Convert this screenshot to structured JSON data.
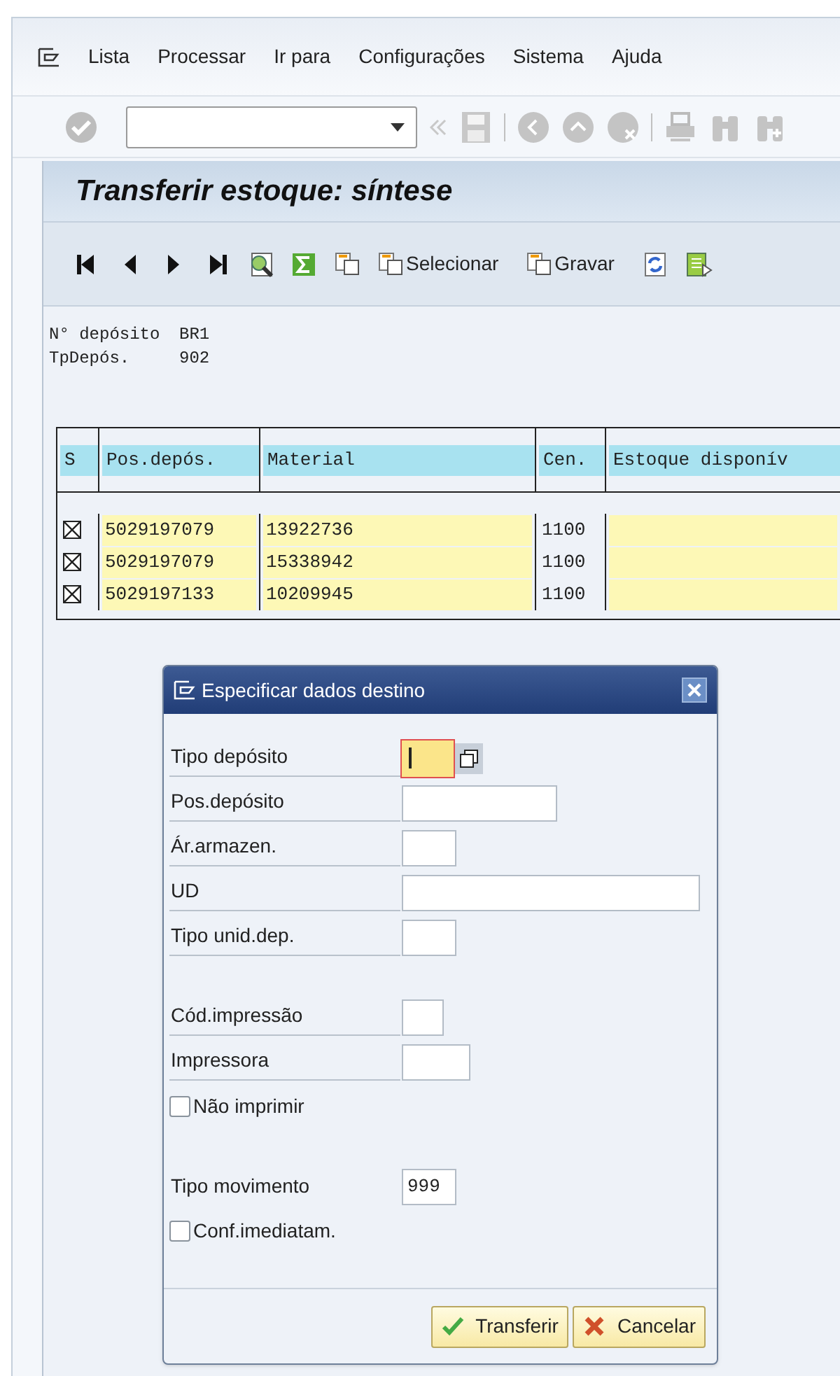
{
  "menu": [
    "Lista",
    "Processar",
    "Ir para",
    "Configurações",
    "Sistema",
    "Ajuda"
  ],
  "title": "Transferir estoque: síntese",
  "app_toolbar": [
    {
      "kind": "first"
    },
    {
      "kind": "prev"
    },
    {
      "kind": "next"
    },
    {
      "kind": "last"
    },
    {
      "kind": "details"
    },
    {
      "kind": "sum"
    },
    {
      "kind": "copy"
    },
    {
      "kind": "copy",
      "label": "Selecionar"
    },
    {
      "kind": "copy",
      "label": "Gravar"
    },
    {
      "kind": "refresh"
    },
    {
      "kind": "list"
    }
  ],
  "header_fields": [
    {
      "label": "N° depósito",
      "value": "BR1"
    },
    {
      "label": "TpDepós.",
      "value": "902"
    }
  ],
  "table": {
    "columns": [
      "S",
      "Pos.depós.",
      "Material",
      "Cen.",
      "Estoque disponív"
    ],
    "rows": [
      {
        "selected": true,
        "cells": [
          "",
          "5029197079",
          "13922736",
          "1100"
        ]
      },
      {
        "selected": true,
        "cells": [
          "",
          "5029197079",
          "15338942",
          "1100"
        ]
      },
      {
        "selected": true,
        "cells": [
          "",
          "5029197133",
          "10209945",
          "1100"
        ]
      }
    ]
  },
  "dialog": {
    "title": "Especificar dados destino",
    "sections": [
      [
        {
          "kind": "field",
          "label": "Tipo depósito",
          "focused": true
        },
        {
          "kind": "field",
          "label": "Pos.depósito",
          "focused": false
        },
        {
          "kind": "field",
          "label": "Ár.armazen.",
          "focused": false
        },
        {
          "kind": "field",
          "label": "UD",
          "focused": false
        },
        {
          "kind": "field",
          "label": "Tipo unid.dep.",
          "focused": false
        }
      ],
      [
        {
          "kind": "field",
          "label": "Cód.impressão",
          "focused": false
        },
        {
          "kind": "field",
          "label": "Impressora",
          "focused": false
        },
        {
          "kind": "checkbox",
          "label": "Não imprimir",
          "checked": false
        }
      ],
      [
        {
          "kind": "plainfield",
          "label": "Tipo movimento",
          "value": "999"
        },
        {
          "kind": "checkbox",
          "label": "Conf.imediatam.",
          "checked": false
        }
      ]
    ],
    "buttons": [
      {
        "kind": "ok",
        "label": "Transferir"
      },
      {
        "kind": "cancel",
        "label": "Cancelar"
      }
    ]
  }
}
